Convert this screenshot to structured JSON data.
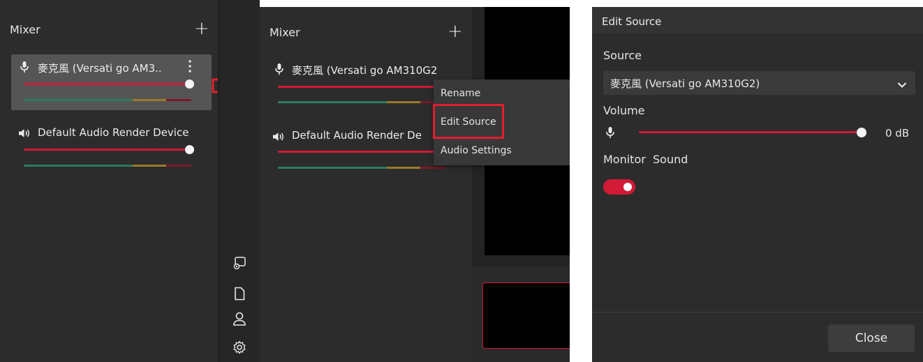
{
  "left_panel": {
    "title": "Mixer",
    "items": [
      {
        "label": "麥克風 (Versati go AM3..",
        "icon": "microphone-icon"
      },
      {
        "label": "Default Audio Render Device",
        "icon": "speaker-icon"
      }
    ]
  },
  "middle_panel": {
    "title": "Mixer",
    "items": [
      {
        "label": "麥克風 (Versati go AM310G2",
        "icon": "microphone-icon"
      },
      {
        "label": "Default Audio Render De",
        "icon": "speaker-icon"
      }
    ],
    "context_menu": [
      "Rename",
      "Edit Source",
      "Audio Settings"
    ],
    "highlighted_item": "Edit Source"
  },
  "sidebar_icons": [
    "screen-settings-icon",
    "document-icon",
    "user-icon",
    "gear-icon"
  ],
  "dialog": {
    "title": "Edit Source",
    "source_label": "Source",
    "source_value": "麥克風 (Versati go AM310G2)",
    "volume_label": "Volume",
    "volume_value": "0 dB",
    "monitor_label": "Monitor  Sound",
    "monitor_on": true,
    "close_label": "Close"
  },
  "colors": {
    "accent_red": "#d11a35",
    "highlight_border": "#e0202e",
    "panel_bg": "#2b2b2b"
  }
}
